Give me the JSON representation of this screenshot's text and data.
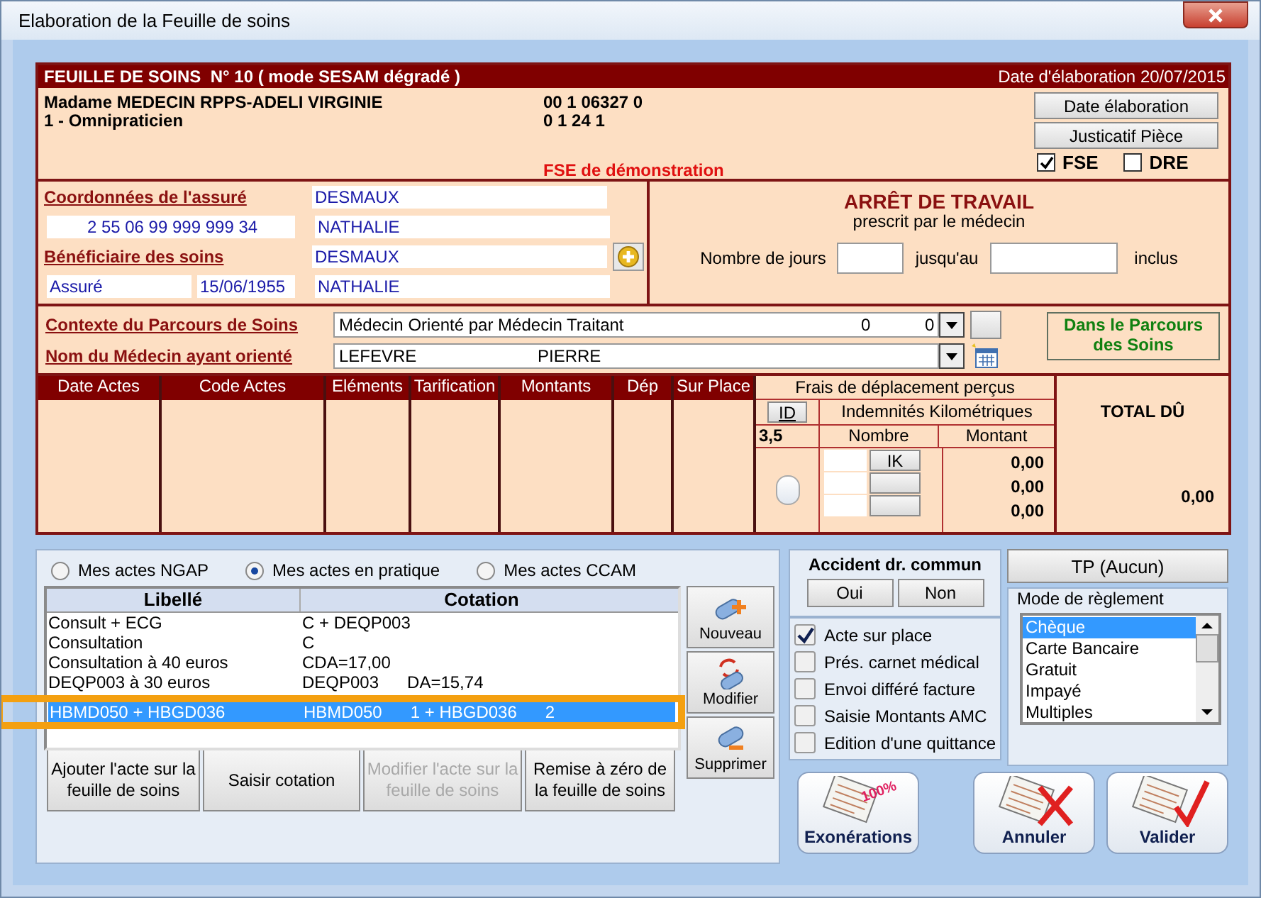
{
  "window": {
    "title": "Elaboration de la Feuille de soins"
  },
  "header": {
    "title": "FEUILLE DE SOINS  N° 10 ( mode SESAM dégradé )",
    "date": "Date d'élaboration 20/07/2015"
  },
  "practitioner": {
    "name": "Madame MEDECIN RPPS-ADELI VIRGINIE",
    "specialty": "1 - Omnipraticien",
    "number_1": "00 1 06327 0",
    "number_2": "0 1 24 1",
    "demo_notice": "FSE de démonstration"
  },
  "header_buttons": [
    "Date élaboration",
    "Justicatif Pièce"
  ],
  "flags": [
    {
      "label": "FSE",
      "checked": true
    },
    {
      "label": "DRE",
      "checked": false
    }
  ],
  "insured": {
    "title": "Coordonnées de l'assuré",
    "surname": "DESMAUX",
    "nir": "2 55 06 99 999 999 34",
    "firstname": "NATHALIE"
  },
  "beneficiary": {
    "title": "Bénéficiaire des soins",
    "surname": "DESMAUX",
    "quality": "Assuré",
    "birthdate": "15/06/1955",
    "firstname": "NATHALIE"
  },
  "work_stop": {
    "title": "ARRÊT DE TRAVAIL",
    "subtitle": "prescrit par le médecin",
    "days_label": "Nombre de jours",
    "until_label": "jusqu'au",
    "inclusive_label": "inclus"
  },
  "care_path": {
    "context_label": "Contexte du Parcours de Soins",
    "context_value": "Médecin Orienté par Médecin Traitant",
    "context_code_1": "0",
    "context_code_2": "0",
    "doctor_label": "Nom du Médecin ayant orienté",
    "doctor_surname": "LEFEVRE",
    "doctor_firstname": "PIERRE",
    "status": "Dans le Parcours des Soins"
  },
  "acts_table": {
    "columns": [
      "Date Actes",
      "Code Actes",
      "Eléments",
      "Tarification",
      "Montants",
      "Dép",
      "Sur Place"
    ]
  },
  "travel": {
    "title": "Frais de déplacement perçus",
    "id_button": "ID",
    "id_value": "3,5",
    "km_title": "Indemnités Kilométriques",
    "number_header": "Nombre",
    "amount_header": "Montant",
    "ik_button": "IK",
    "sur_place_checked": false,
    "amounts": [
      "0,00",
      "0,00",
      "0,00"
    ]
  },
  "total": {
    "label": "TOTAL DÛ",
    "value": "0,00"
  },
  "act_sources": [
    {
      "label": "Mes actes NGAP",
      "selected": false
    },
    {
      "label": "Mes actes en pratique",
      "selected": true
    },
    {
      "label": "Mes actes CCAM",
      "selected": false
    }
  ],
  "acts_list": {
    "columns": [
      "Libellé",
      "Cotation"
    ],
    "rows": [
      {
        "label": "Consult + ECG",
        "cotation": "C + DEQP003",
        "selected": false,
        "highlighted": false
      },
      {
        "label": "Consultation",
        "cotation": "C",
        "selected": false,
        "highlighted": false
      },
      {
        "label": "Consultation à 40 euros",
        "cotation": "CDA=17,00",
        "selected": false,
        "highlighted": false
      },
      {
        "label": "DEQP003 à 30 euros",
        "cotation": "DEQP003      DA=15,74",
        "selected": false,
        "highlighted": false
      },
      {
        "label": "HBMD050 + HBGD036",
        "cotation": "HBMD050      1 + HBGD036      2",
        "selected": true,
        "highlighted": true
      }
    ]
  },
  "side_buttons": [
    {
      "label": "Nouveau",
      "kind": "new"
    },
    {
      "label": "Modifier",
      "kind": "edit"
    },
    {
      "label": "Supprimer",
      "kind": "delete"
    }
  ],
  "act_buttons": [
    {
      "label": "Ajouter l'acte sur la feuille de soins",
      "disabled": false
    },
    {
      "label": "Saisir cotation",
      "disabled": false
    },
    {
      "label": "Modifier l'acte sur la feuille de soins",
      "disabled": true
    },
    {
      "label": "Remise à zéro de la feuille de soins",
      "disabled": false
    }
  ],
  "accident": {
    "title": "Accident dr. commun",
    "buttons": [
      "Oui",
      "Non"
    ]
  },
  "options": [
    {
      "label": "Acte sur place",
      "checked": true
    },
    {
      "label": "Prés. carnet médical",
      "checked": false
    },
    {
      "label": "Envoi différé facture",
      "checked": false
    },
    {
      "label": "Saisie Montants AMC",
      "checked": false
    },
    {
      "label": "Edition d'une quittance",
      "checked": false
    }
  ],
  "tp_button": "TP (Aucun)",
  "payment": {
    "title": "Mode de règlement",
    "items": [
      {
        "label": "Chèque",
        "selected": true
      },
      {
        "label": "Carte Bancaire",
        "selected": false
      },
      {
        "label": "Gratuit",
        "selected": false
      },
      {
        "label": "Impayé",
        "selected": false
      },
      {
        "label": "Multiples",
        "selected": false
      }
    ]
  },
  "action_buttons": [
    {
      "label": "Exonérations",
      "kind": "exemption",
      "badge": "100%"
    },
    {
      "label": "Annuler",
      "kind": "cancel"
    },
    {
      "label": "Valider",
      "kind": "validate"
    }
  ]
}
